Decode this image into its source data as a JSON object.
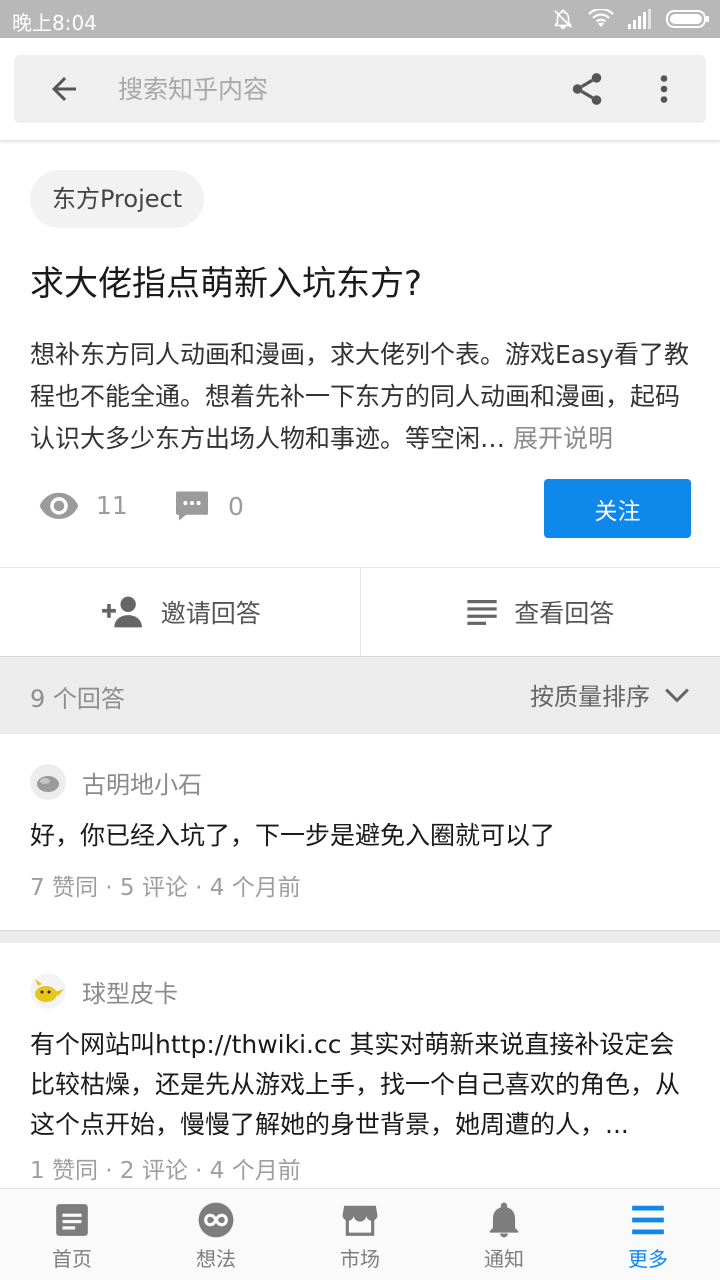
{
  "status_bar": {
    "time": "晚上8:04"
  },
  "header": {
    "search_placeholder": "搜索知乎内容"
  },
  "question": {
    "topic": "东方Project",
    "title": "求大佬指点萌新入坑东方?",
    "description": "想补东方同人动画和漫画，求大佬列个表。游戏Easy看了教程也不能全通。想着先补一下东方的同人动画和漫画，起码认识大多少东方出场人物和事迹。等空闲…",
    "expand_label": "展开说明",
    "views": "11",
    "comments": "0",
    "follow_label": "关注"
  },
  "actions": {
    "invite_label": "邀请回答",
    "view_label": "查看回答"
  },
  "answers_header": {
    "count_label": "9 个回答",
    "sort_label": "按质量排序"
  },
  "answers": [
    {
      "author": "古明地小石",
      "text": "好，你已经入坑了，下一步是避免入圈就可以了",
      "meta": "7 赞同 · 5 评论 · 4 个月前"
    },
    {
      "author": "球型皮卡",
      "text": "有个网站叫http://thwiki.cc 其实对萌新来说直接补设定会比较枯燥，还是先从游戏上手，找一个自己喜欢的角色，从这个点开始，慢慢了解她的身世背景，她周遭的人，...",
      "meta": "1 赞同 · 2 评论 · 4 个月前"
    }
  ],
  "bottom_nav": [
    {
      "label": "首页",
      "icon": "home-icon"
    },
    {
      "label": "想法",
      "icon": "idea-icon"
    },
    {
      "label": "市场",
      "icon": "market-icon"
    },
    {
      "label": "通知",
      "icon": "bell-icon"
    },
    {
      "label": "更多",
      "icon": "menu-icon"
    }
  ],
  "colors": {
    "accent": "#0f88eb",
    "status_bar": "#b8b8b8",
    "section_bg": "#ececec"
  }
}
